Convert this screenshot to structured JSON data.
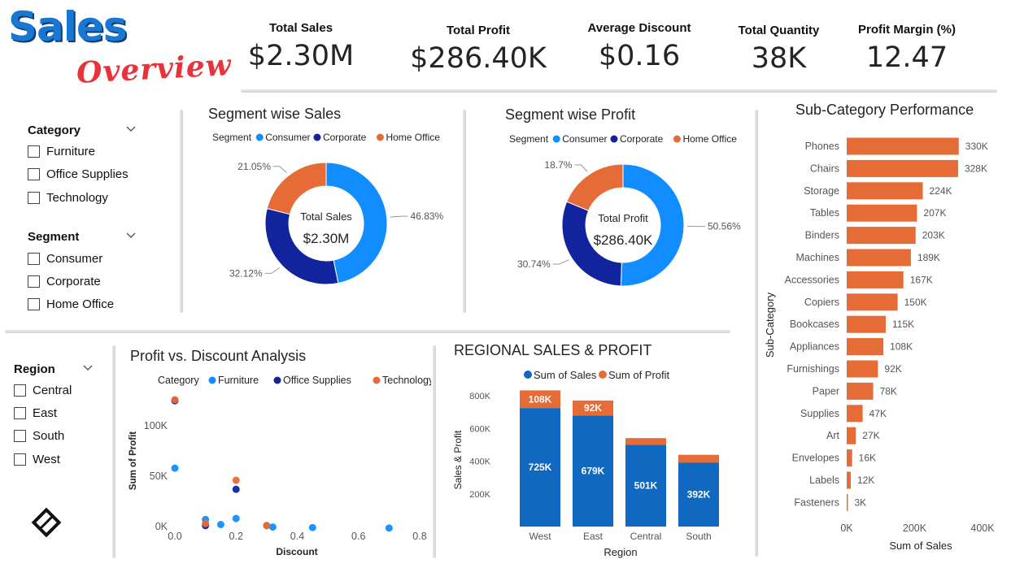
{
  "logo": {
    "line1": "Sales",
    "line2": "Overview"
  },
  "kpis": [
    {
      "label": "Total Sales",
      "value": "$2.30M"
    },
    {
      "label": "Total Profit",
      "value": "$286.40K"
    },
    {
      "label": "Average Discount",
      "value": "$0.16"
    },
    {
      "label": "Total Quantity",
      "value": "38K"
    },
    {
      "label": "Profit Margin (%)",
      "value": "12.47"
    }
  ],
  "slicers": {
    "category": {
      "title": "Category",
      "items": [
        "Furniture",
        "Office Supplies",
        "Technology"
      ]
    },
    "segment": {
      "title": "Segment",
      "items": [
        "Consumer",
        "Corporate",
        "Home Office"
      ]
    },
    "region": {
      "title": "Region",
      "items": [
        "Central",
        "East",
        "South",
        "West"
      ]
    }
  },
  "colors": {
    "consumer": "#118dff",
    "corporate": "#12239e",
    "home_office": "#e66c37",
    "bar_orange": "#e66c37",
    "sales_blue": "#1068c1",
    "accent_text": "#252423"
  },
  "icons": {
    "brand": "diamond-logo-icon",
    "dropdown": "chevron-down-icon"
  },
  "chart_data": [
    {
      "id": "segment_sales",
      "type": "pie",
      "title": "Segment wise Sales",
      "legend_title": "Segment",
      "legend_position": "top",
      "categories": [
        "Consumer",
        "Corporate",
        "Home Office"
      ],
      "values": [
        46.83,
        32.12,
        21.05
      ],
      "labels": [
        "46.83%",
        "32.12%",
        "21.05%"
      ],
      "center_label": "Total Sales",
      "center_value": "$2.30M"
    },
    {
      "id": "segment_profit",
      "type": "pie",
      "title": "Segment wise Profit",
      "legend_title": "Segment",
      "legend_position": "top",
      "categories": [
        "Consumer",
        "Corporate",
        "Home Office"
      ],
      "values": [
        50.56,
        30.74,
        18.7
      ],
      "labels": [
        "50.56%",
        "30.74%",
        "18.7%"
      ],
      "center_label": "Total Profit",
      "center_value": "$286.40K"
    },
    {
      "id": "subcategory",
      "type": "bar",
      "orientation": "horizontal",
      "title": "Sub-Category Performance",
      "xlabel": "Sum of Sales",
      "ylabel": "Sub-Category",
      "xlim": [
        0,
        400000
      ],
      "x_ticks": [
        "0K",
        "200K",
        "400K"
      ],
      "categories": [
        "Phones",
        "Chairs",
        "Storage",
        "Tables",
        "Binders",
        "Machines",
        "Accessories",
        "Copiers",
        "Bookcases",
        "Appliances",
        "Furnishings",
        "Paper",
        "Supplies",
        "Art",
        "Envelopes",
        "Labels",
        "Fasteners"
      ],
      "values": [
        330000,
        328000,
        224000,
        207000,
        203000,
        189000,
        167000,
        150000,
        115000,
        108000,
        92000,
        78000,
        47000,
        27000,
        16000,
        12000,
        3000
      ],
      "data_labels": [
        "330K",
        "328K",
        "224K",
        "207K",
        "203K",
        "189K",
        "167K",
        "150K",
        "115K",
        "108K",
        "92K",
        "78K",
        "47K",
        "27K",
        "16K",
        "12K",
        "3K"
      ]
    },
    {
      "id": "profit_discount",
      "type": "scatter",
      "title": "Profit vs. Discount Analysis",
      "legend_title": "Category",
      "legend_position": "top",
      "xlabel": "Discount",
      "ylabel": "Sum of Profit",
      "xlim": [
        0,
        0.8
      ],
      "ylim": [
        0,
        130000
      ],
      "x_ticks": [
        "0.0",
        "0.2",
        "0.4",
        "0.6",
        "0.8"
      ],
      "y_ticks": [
        "0K",
        "50K",
        "100K"
      ],
      "series": [
        {
          "name": "Furniture",
          "points": [
            [
              0.0,
              58000
            ],
            [
              0.1,
              7000
            ],
            [
              0.15,
              2000
            ],
            [
              0.2,
              8000
            ],
            [
              0.3,
              1000
            ],
            [
              0.32,
              -500
            ],
            [
              0.45,
              -1000
            ],
            [
              0.7,
              -1500
            ]
          ]
        },
        {
          "name": "Office Supplies",
          "points": [
            [
              0.0,
              125000
            ],
            [
              0.2,
              37000
            ],
            [
              0.1,
              1000
            ]
          ]
        },
        {
          "name": "Technology",
          "points": [
            [
              0.0,
              126000
            ],
            [
              0.2,
              46000
            ],
            [
              0.1,
              3000
            ],
            [
              0.3,
              1000
            ]
          ]
        }
      ]
    },
    {
      "id": "regional",
      "type": "bar",
      "stacked": true,
      "title": "REGIONAL SALES & PROFIT",
      "xlabel": "Region",
      "ylabel": "Sales & Profit",
      "ylim": [
        0,
        850000
      ],
      "y_ticks": [
        "200K",
        "400K",
        "600K",
        "800K"
      ],
      "categories": [
        "West",
        "East",
        "Central",
        "South"
      ],
      "series": [
        {
          "name": "Sum of Sales",
          "values": [
            725000,
            679000,
            501000,
            392000
          ],
          "data_labels": [
            "725K",
            "679K",
            "501K",
            "392K"
          ]
        },
        {
          "name": "Sum of Profit",
          "values": [
            108000,
            92000,
            40000,
            47000
          ],
          "data_labels": [
            "108K",
            "92K",
            "",
            ""
          ]
        }
      ]
    }
  ]
}
